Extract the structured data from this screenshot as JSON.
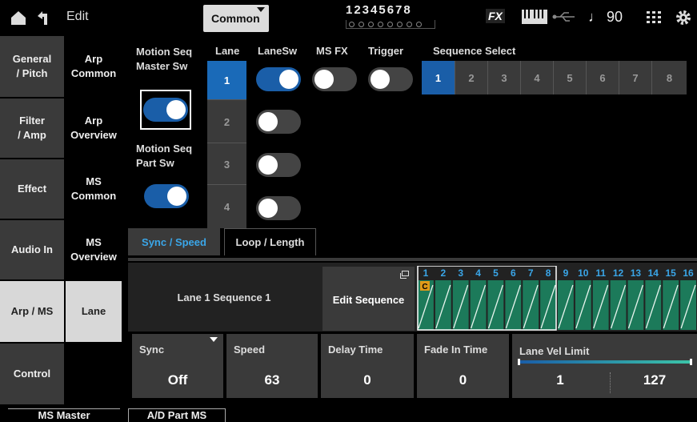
{
  "header": {
    "title": "Edit",
    "common_label": "Common",
    "parts_numbers": "12345678",
    "fx_label": "FX",
    "tempo": "♩ 90"
  },
  "nav_primary": [
    {
      "label": "General\n/ Pitch",
      "active": false
    },
    {
      "label": "Filter\n/ Amp",
      "active": false
    },
    {
      "label": "Effect",
      "active": false
    },
    {
      "label": "Audio In",
      "active": false
    },
    {
      "label": "Arp / MS",
      "active": true
    },
    {
      "label": "Control",
      "active": false
    }
  ],
  "nav_secondary": [
    {
      "label": "Arp\nCommon",
      "active": false
    },
    {
      "label": "Arp\nOverview",
      "active": false
    },
    {
      "label": "MS\nCommon",
      "active": false
    },
    {
      "label": "MS\nOverview",
      "active": false
    },
    {
      "label": "Lane",
      "active": true
    }
  ],
  "main": {
    "ms_master_sw_label": "Motion Seq\nMaster Sw",
    "ms_part_sw_label": "Motion Seq\nPart Sw",
    "ms_master_sw": true,
    "ms_part_sw": true,
    "lane_header": "Lane",
    "lanesw_header": "LaneSw",
    "msfx_header": "MS FX",
    "trigger_header": "Trigger",
    "seq_select_header": "Sequence Select",
    "lanes": [
      "1",
      "2",
      "3",
      "4"
    ],
    "lane_switches": [
      true,
      false,
      false,
      false
    ],
    "ms_fx": false,
    "trigger": false,
    "sequence_select": [
      "1",
      "2",
      "3",
      "4",
      "5",
      "6",
      "7",
      "8"
    ],
    "selected_sequence": "1"
  },
  "tabs": [
    {
      "label": "Sync / Speed",
      "active": true
    },
    {
      "label": "Loop / Length",
      "active": false
    }
  ],
  "sequence": {
    "title": "Lane 1 Sequence 1",
    "edit_button": "Edit Sequence",
    "step_numbers": [
      "1",
      "2",
      "3",
      "4",
      "5",
      "6",
      "7",
      "8",
      "9",
      "10",
      "11",
      "12",
      "13",
      "14",
      "15",
      "16"
    ],
    "marker": "C"
  },
  "params": {
    "sync_label": "Sync",
    "sync_value": "Off",
    "speed_label": "Speed",
    "speed_value": "63",
    "delay_label": "Delay Time",
    "delay_value": "0",
    "fade_label": "Fade In Time",
    "fade_value": "0",
    "vel_label": "Lane Vel Limit",
    "vel_low": "1",
    "vel_high": "127"
  },
  "bottom_tabs": [
    "MS Master",
    "A/D Part MS"
  ],
  "colors": {
    "accent": "#1a5ea8",
    "lane_accent": "#1a6ab8",
    "step_fill": "#1c7a5a",
    "marker": "#e09a18"
  }
}
